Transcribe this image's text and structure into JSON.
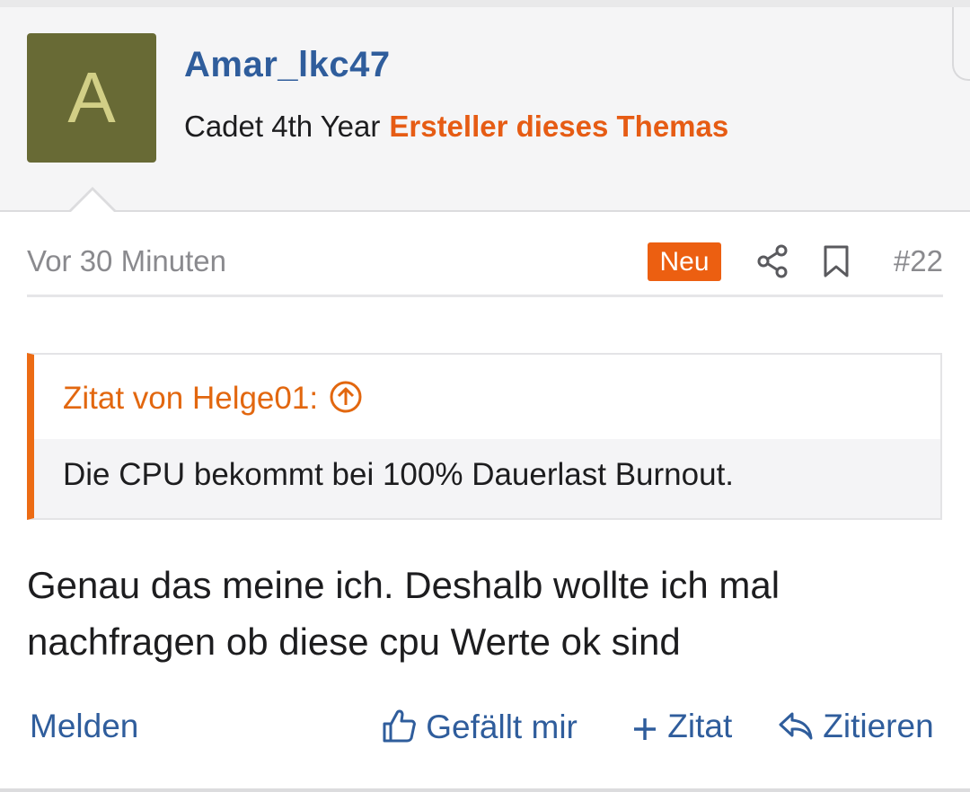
{
  "post": {
    "author": {
      "avatar_letter": "A",
      "username": "Amar_lkc47",
      "rank": "Cadet 4th Year",
      "op_label": "Ersteller dieses Themas",
      "avatar_color": "#686a35"
    },
    "meta": {
      "time": "Vor 30 Minuten",
      "badge": "Neu",
      "post_number": "#22"
    },
    "quote": {
      "author_label": "Zitat von Helge01:",
      "text": "Die CPU bekommt bei 100% Dauerlast Burnout."
    },
    "message": "Genau das meine ich. Deshalb wollte ich mal nachfragen ob diese cpu Werte ok sind",
    "actions": {
      "report": "Melden",
      "like": "Gefällt mir",
      "quote": "Zitat",
      "reply": "Zitieren"
    }
  },
  "icons": {
    "share": "share-icon",
    "bookmark": "bookmark-icon",
    "quote_jump": "arrow-up-circle-icon",
    "like": "thumbs-up-icon",
    "add_quote": "plus-icon",
    "reply": "reply-arrow-icon"
  },
  "colors": {
    "accent_orange": "#ec5f11",
    "link_blue": "#2f5d9c"
  }
}
